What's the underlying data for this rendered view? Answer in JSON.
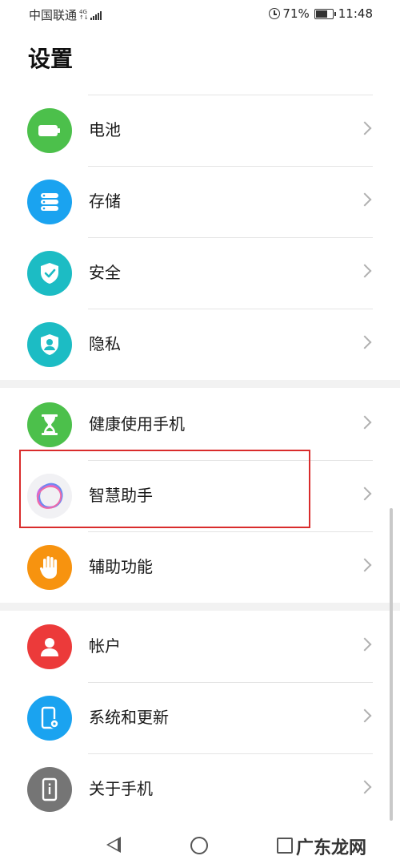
{
  "status_bar": {
    "carrier": "中国联通",
    "network_top": "4G",
    "network_bottom": "↑↓",
    "battery_percent": "71%",
    "battery_level": 0.71,
    "time": "11:48"
  },
  "page": {
    "title": "设置"
  },
  "groups": [
    {
      "items": [
        {
          "label": "电池",
          "icon": "battery-icon",
          "color": "#4cc04b"
        },
        {
          "label": "存储",
          "icon": "storage-icon",
          "color": "#1aa3f0"
        },
        {
          "label": "安全",
          "icon": "shield-check-icon",
          "color": "#1cbcc4"
        },
        {
          "label": "隐私",
          "icon": "privacy-icon",
          "color": "#1cbcc4"
        }
      ]
    },
    {
      "items": [
        {
          "label": "健康使用手机",
          "icon": "hourglass-icon",
          "color": "#4cc04b"
        },
        {
          "label": "智慧助手",
          "icon": "assistant-ring-icon",
          "color": "#f1f1f4"
        },
        {
          "label": "辅助功能",
          "icon": "hand-icon",
          "color": "#f7930f"
        }
      ]
    },
    {
      "items": [
        {
          "label": "帐户",
          "icon": "account-icon",
          "color": "#ec3a3a"
        },
        {
          "label": "系统和更新",
          "icon": "system-update-icon",
          "color": "#1aa3f0"
        },
        {
          "label": "关于手机",
          "icon": "about-phone-icon",
          "color": "#757575"
        }
      ]
    }
  ],
  "highlight_color": "#d92c2c",
  "watermark": "广东龙网"
}
